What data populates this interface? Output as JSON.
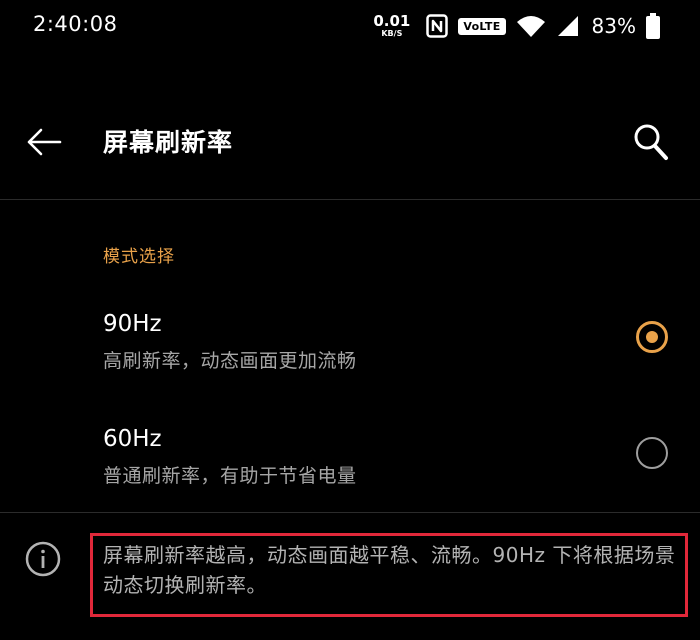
{
  "status_bar": {
    "time": "2:40:08",
    "net_speed_value": "0.01",
    "net_speed_unit": "KB/S",
    "volte": "VoLTE",
    "battery": "83%"
  },
  "app_bar": {
    "title": "屏幕刷新率",
    "icons": [
      "back-arrow-icon",
      "search-icon"
    ]
  },
  "section": {
    "header": "模式选择"
  },
  "options": [
    {
      "title": "90Hz",
      "description": "高刷新率，动态画面更加流畅",
      "selected": true
    },
    {
      "title": "60Hz",
      "description": "普通刷新率，有助于节省电量",
      "selected": false
    }
  ],
  "info": {
    "text": "屏幕刷新率越高，动态画面越平稳、流畅。90Hz 下将根据场景动态切换刷新率。"
  },
  "colors": {
    "accent": "#e9a24a",
    "background": "#000000",
    "highlight_box": "#e0283a"
  }
}
